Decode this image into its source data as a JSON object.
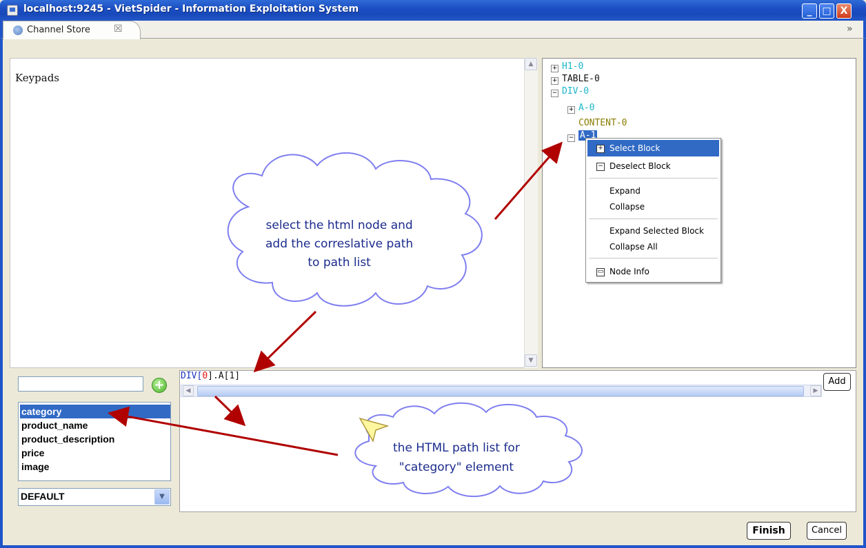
{
  "window": {
    "title": "localhost:9245 - VietSpider - Information Exploitation System",
    "controls": {
      "minimize": "_",
      "maximize": "□",
      "close": "X"
    }
  },
  "tab": {
    "label": "Channel Store",
    "close_glyph": "☒",
    "overflow_glyph": "»"
  },
  "preview": {
    "text": "Keypads"
  },
  "tree": {
    "nodes": [
      {
        "label": "H1-0",
        "expander": "+"
      },
      {
        "label": "TABLE-0",
        "expander": "+"
      },
      {
        "label": "DIV-0",
        "expander": "−"
      },
      {
        "label": "A-0",
        "expander": "+"
      },
      {
        "label": "CONTENT-0",
        "expander": ""
      },
      {
        "label": "A-1",
        "expander": "−"
      }
    ]
  },
  "context_menu": {
    "items": [
      {
        "label": "Select Block",
        "icon": "+"
      },
      {
        "label": "Deselect Block",
        "icon": "−"
      },
      {
        "label": "Expand"
      },
      {
        "label": "Collapse"
      },
      {
        "label": "Expand Selected Block"
      },
      {
        "label": "Collapse All"
      },
      {
        "label": "Node Info",
        "icon": "▭"
      }
    ]
  },
  "fields": {
    "input_value": "",
    "items": [
      "category",
      "product_name",
      "product_description",
      "price",
      "image"
    ],
    "selected": "category",
    "group_select": "DEFAULT"
  },
  "path": {
    "prefix": "DIV[",
    "index": "0",
    "suffix": "].A[1]",
    "add_label": "Add"
  },
  "buttons": {
    "finish": "Finish",
    "cancel": "Cancel"
  },
  "annotations": {
    "cloud1": [
      "select the html node and",
      "add the correslative path",
      "to path list"
    ],
    "cloud2": [
      "the HTML path list for",
      "\"category\" element"
    ]
  },
  "colors": {
    "accent": "#316ac5",
    "title_blue": "#1f55c9",
    "arrow": "#b00000",
    "cloud_border": "#7e7ef0"
  }
}
